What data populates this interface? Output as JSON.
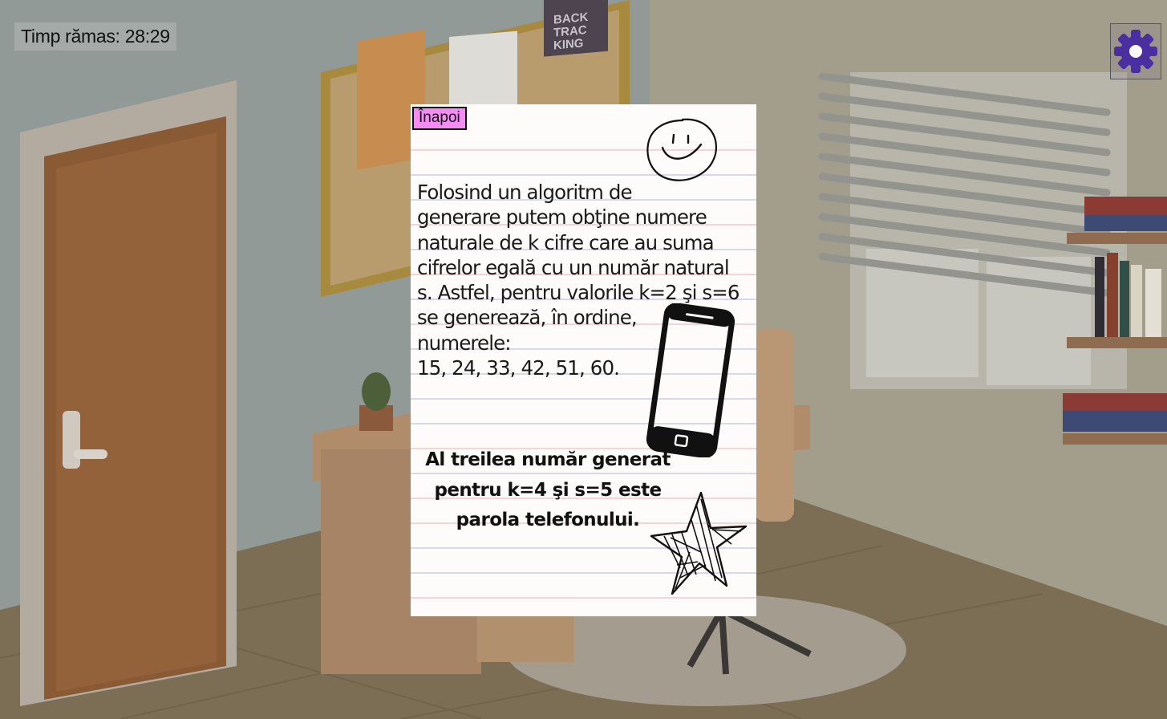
{
  "hud": {
    "timer_label": "Timp rămas: 28:29",
    "settings_icon": "gear-icon"
  },
  "note": {
    "back_button": "Înapoi",
    "problem_text": "Folosind un algoritm de\ngenerare putem obţine numere\nnaturale de k cifre care au suma\ncifrelor egală cu un număr natural\ns. Astfel, pentru valorile k=2 şi s=6\nse generează, în ordine,\nnumerele:\n15, 24, 33, 42, 51, 60.",
    "task_text": "Al treilea număr generat pentru k=4 şi s=5 este parola telefonului.",
    "doodles": [
      "smiley-face-icon",
      "phone-icon",
      "star-icon"
    ]
  },
  "background_poster": "BACK TRAC KING",
  "colors": {
    "back_button": "#f58cf5",
    "settings_gear": "#4b2fa0",
    "line_pink": "#f2c6cb",
    "line_blue": "#c9cde0"
  }
}
